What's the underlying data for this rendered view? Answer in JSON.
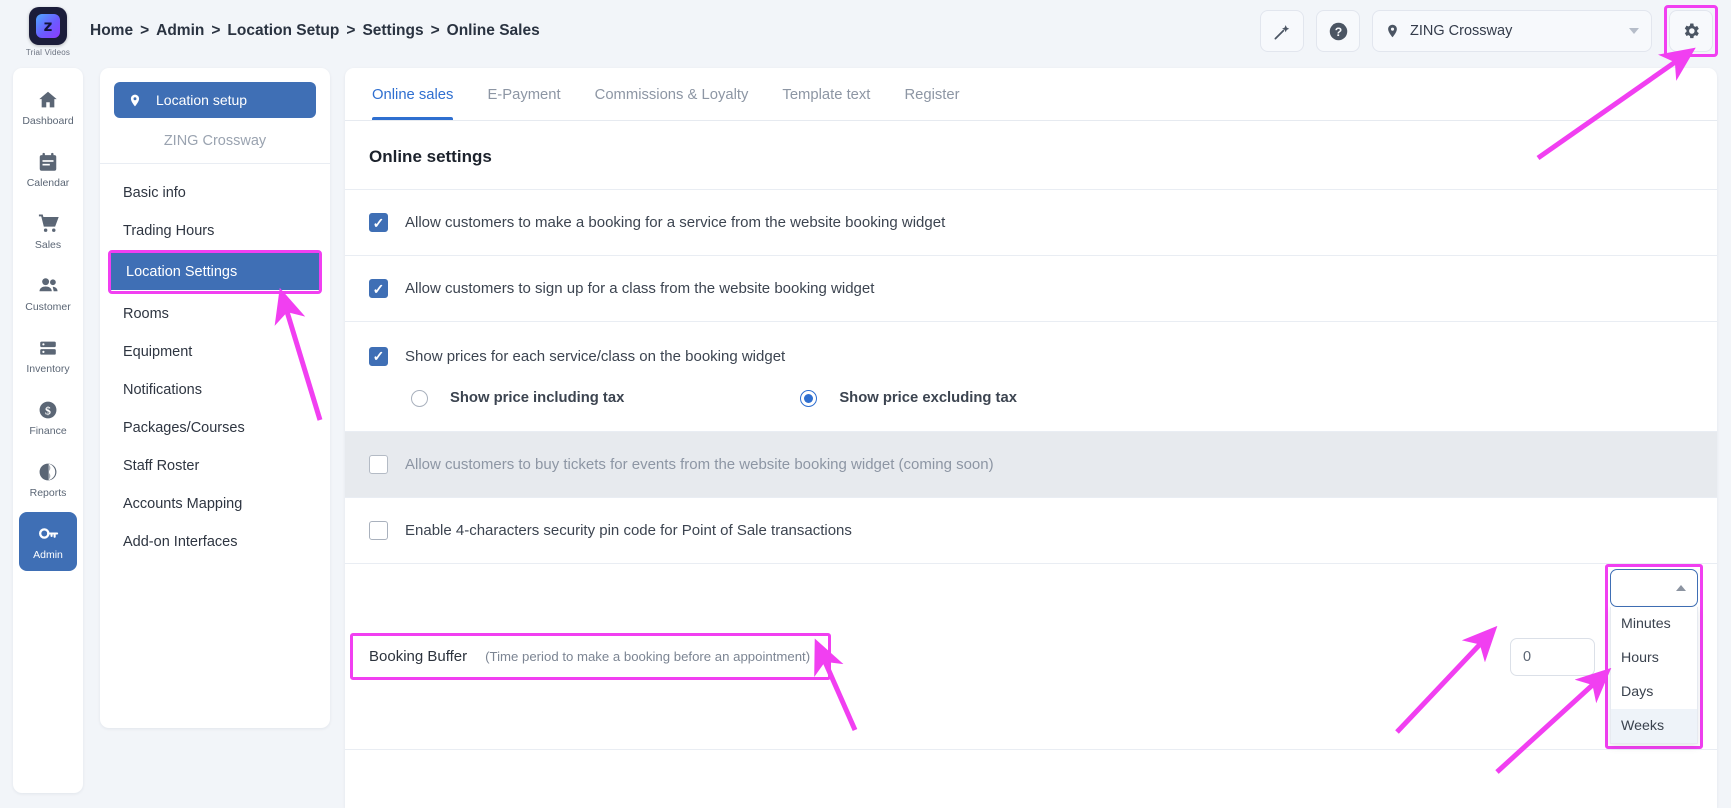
{
  "brand": {
    "logo_glyph": "z",
    "caption": "Trial Videos"
  },
  "breadcrumb": {
    "items": [
      "Home",
      "Admin",
      "Location Setup",
      "Settings",
      "Online Sales"
    ],
    "separator": ">"
  },
  "topbar": {
    "wand_icon": "magic-wand-icon",
    "help_icon": "help-circle-icon",
    "location_value": "ZING Crossway",
    "location_icon": "map-pin-icon",
    "settings_icon": "gear-icon"
  },
  "rail": {
    "items": [
      {
        "label": "Dashboard",
        "icon": "home-icon",
        "active": false
      },
      {
        "label": "Calendar",
        "icon": "calendar-icon",
        "active": false
      },
      {
        "label": "Sales",
        "icon": "shopping-cart-icon",
        "active": false
      },
      {
        "label": "Customer",
        "icon": "people-icon",
        "active": false
      },
      {
        "label": "Inventory",
        "icon": "server-icon",
        "active": false
      },
      {
        "label": "Finance",
        "icon": "dollar-coin-icon",
        "active": false
      },
      {
        "label": "Reports",
        "icon": "pie-chart-icon",
        "active": false
      },
      {
        "label": "Admin",
        "icon": "key-icon",
        "active": true
      }
    ]
  },
  "subnav": {
    "header": "Location setup",
    "header_icon": "map-pin-icon",
    "location_name": "ZING Crossway",
    "items": [
      {
        "label": "Basic info",
        "active": false,
        "highlighted": false
      },
      {
        "label": "Trading Hours",
        "active": false,
        "highlighted": false
      },
      {
        "label": "Location Settings",
        "active": true,
        "highlighted": true
      },
      {
        "label": "Rooms",
        "active": false,
        "highlighted": false
      },
      {
        "label": "Equipment",
        "active": false,
        "highlighted": false
      },
      {
        "label": "Notifications",
        "active": false,
        "highlighted": false
      },
      {
        "label": "Packages/Courses",
        "active": false,
        "highlighted": false
      },
      {
        "label": "Staff Roster",
        "active": false,
        "highlighted": false
      },
      {
        "label": "Accounts Mapping",
        "active": false,
        "highlighted": false
      },
      {
        "label": "Add-on Interfaces",
        "active": false,
        "highlighted": false
      }
    ]
  },
  "main": {
    "tabs": [
      {
        "label": "Online sales",
        "active": true
      },
      {
        "label": "E-Payment",
        "active": false
      },
      {
        "label": "Commissions & Loyalty",
        "active": false
      },
      {
        "label": "Template text",
        "active": false
      },
      {
        "label": "Register",
        "active": false
      }
    ],
    "section_title": "Online settings",
    "options": [
      {
        "label": "Allow customers to make a booking for a service from the website booking widget",
        "checked": true,
        "disabled": false
      },
      {
        "label": "Allow customers to sign up for a class from the website booking widget",
        "checked": true,
        "disabled": false
      },
      {
        "label": "Show prices for each service/class on the booking widget",
        "checked": true,
        "disabled": false
      },
      {
        "label": "Allow customers to buy tickets for events from the website booking widget (coming soon)",
        "checked": false,
        "disabled": true
      },
      {
        "label": "Enable 4-characters security pin code for Point of Sale transactions",
        "checked": false,
        "disabled": false
      }
    ],
    "tax_radios": [
      {
        "label": "Show price including tax",
        "selected": false
      },
      {
        "label": "Show price excluding tax",
        "selected": true
      }
    ],
    "booking_buffer": {
      "label": "Booking Buffer",
      "hint": "(Time period to make a booking before an appointment)",
      "amount_value": "0",
      "unit_value": "",
      "unit_options": [
        "Minutes",
        "Hours",
        "Days",
        "Weeks"
      ],
      "unit_hovered": "Weeks",
      "caret_icon": "chevron-up-icon"
    }
  },
  "annotation": {
    "color": "#f13ff1",
    "highlights": [
      "gear-button",
      "location-settings-item",
      "booking-buffer-label",
      "number-input",
      "unit-dropdown"
    ]
  }
}
